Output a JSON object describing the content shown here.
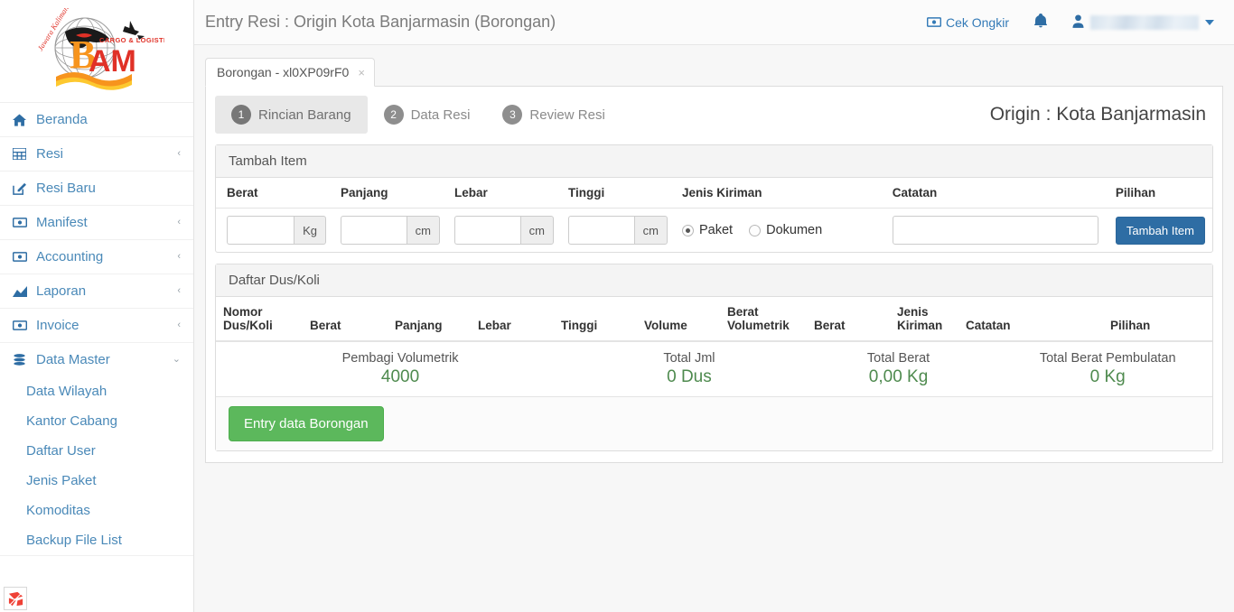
{
  "brand": {
    "logo_alt": "BAM Cargo & Logistic",
    "logo_letter_b": "B",
    "logo_letter_am": "AM",
    "logo_tagline": "CARGO & LOGISTIC",
    "logo_script": "Jawara Kalimantan",
    "accent_red": "#e03127",
    "accent_orange": "#f7941d",
    "accent_blue": "#337ab7",
    "accent_green": "#5cb85c"
  },
  "sidebar": {
    "items": [
      {
        "label": "Beranda",
        "icon": "home-icon",
        "expandable": false,
        "arrow": ""
      },
      {
        "label": "Resi",
        "icon": "table-icon",
        "expandable": true,
        "arrow": "‹"
      },
      {
        "label": "Resi Baru",
        "icon": "edit-square-icon",
        "expandable": false,
        "arrow": ""
      },
      {
        "label": "Manifest",
        "icon": "money-bill-icon",
        "expandable": true,
        "arrow": "‹"
      },
      {
        "label": "Accounting",
        "icon": "money-bill-icon",
        "expandable": true,
        "arrow": "‹"
      },
      {
        "label": "Laporan",
        "icon": "area-chart-icon",
        "expandable": true,
        "arrow": "‹"
      },
      {
        "label": "Invoice",
        "icon": "money-bill-icon",
        "expandable": true,
        "arrow": "‹"
      },
      {
        "label": "Data Master",
        "icon": "database-icon",
        "expandable": true,
        "arrow": "⌄",
        "expanded": true
      }
    ],
    "data_master_children": [
      {
        "label": "Data Wilayah"
      },
      {
        "label": "Kantor Cabang"
      },
      {
        "label": "Daftar User"
      },
      {
        "label": "Jenis Paket"
      },
      {
        "label": "Komoditas"
      },
      {
        "label": "Backup File List"
      }
    ],
    "taskbar_icon": "app-shortcut-icon"
  },
  "topbar": {
    "page_title": "Entry Resi : Origin Kota Banjarmasin (Borongan)",
    "cek_ongkir_label": "Cek Ongkir",
    "cek_ongkir_icon": "money-bill-icon",
    "notification_icon": "bell-icon",
    "user_icon": "user-icon",
    "user_name_redacted": "",
    "user_caret_icon": "caret-down-icon"
  },
  "doc_tabs": [
    {
      "label": "Borongan - xl0XP09rF0",
      "close_icon": "×",
      "active": true
    }
  ],
  "stepper": {
    "steps": [
      {
        "number": "1",
        "label": "Rincian Barang",
        "active": true
      },
      {
        "number": "2",
        "label": "Data Resi",
        "active": false
      },
      {
        "number": "3",
        "label": "Review Resi",
        "active": false
      }
    ],
    "origin_label": "Origin : Kota Banjarmasin"
  },
  "tambah_item": {
    "title": "Tambah Item",
    "columns": [
      "Berat",
      "Panjang",
      "Lebar",
      "Tinggi",
      "Jenis Kiriman",
      "Catatan",
      "Pilihan"
    ],
    "fields": {
      "berat": {
        "value": "",
        "placeholder": "",
        "unit": "Kg"
      },
      "panjang": {
        "value": "",
        "placeholder": "",
        "unit": "cm"
      },
      "lebar": {
        "value": "",
        "placeholder": "",
        "unit": "cm"
      },
      "tinggi": {
        "value": "",
        "placeholder": "",
        "unit": "cm"
      },
      "catatan": {
        "value": "",
        "placeholder": ""
      }
    },
    "jenis_kiriman": {
      "options": [
        {
          "label": "Paket",
          "checked": true
        },
        {
          "label": "Dokumen",
          "checked": false
        }
      ]
    },
    "add_button_label": "Tambah Item"
  },
  "daftar_dus": {
    "title": "Daftar Dus/Koli",
    "columns": [
      "Nomor Dus/Koli",
      "Berat",
      "Panjang",
      "Lebar",
      "Tinggi",
      "Volume",
      "Berat Volumetrik",
      "Berat",
      "Jenis Kiriman",
      "Catatan",
      "Pilihan"
    ],
    "rows": [],
    "totals": [
      {
        "label": "Pembagi Volumetrik",
        "value": "4000"
      },
      {
        "label": "Total Jml",
        "value": "0 Dus"
      },
      {
        "label": "Total Berat",
        "value": "0,00 Kg"
      },
      {
        "label": "Total Berat Pembulatan",
        "value": "0 Kg"
      }
    ],
    "submit_label": "Entry data Borongan"
  }
}
